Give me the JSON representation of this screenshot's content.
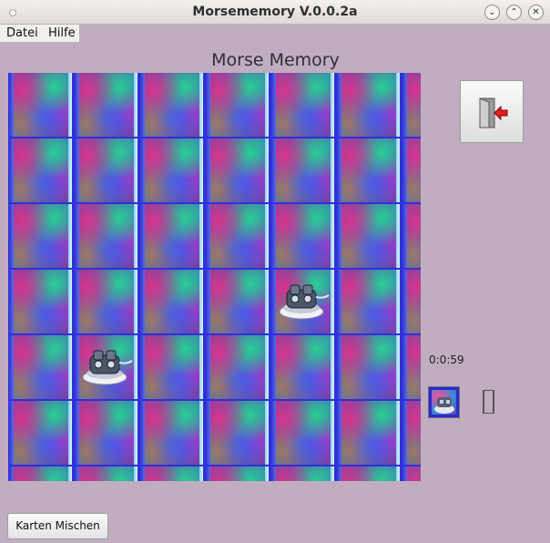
{
  "window": {
    "title": "Morsememory V.0.0.2a",
    "controls": [
      "minimize",
      "maximize",
      "close"
    ]
  },
  "menubar": {
    "items": [
      {
        "label": "Datei"
      },
      {
        "label": "Hilfe"
      }
    ]
  },
  "game": {
    "heading": "Morse Memory",
    "grid": {
      "rows": 7,
      "columns": 7,
      "revealed_cards": [
        {
          "row": 3,
          "col": 4,
          "image": "hovercraft-robot"
        },
        {
          "row": 4,
          "col": 1,
          "image": "hovercraft-robot"
        }
      ]
    },
    "timer": "0:0:59",
    "found_pairs_icon": "matched-card-thumbnail"
  },
  "buttons": {
    "quit_icon": "exit-door-icon",
    "shuffle_label": "Karten Mischen"
  },
  "colors": {
    "background": "#c0adc0",
    "card_border": "#3030d8"
  }
}
